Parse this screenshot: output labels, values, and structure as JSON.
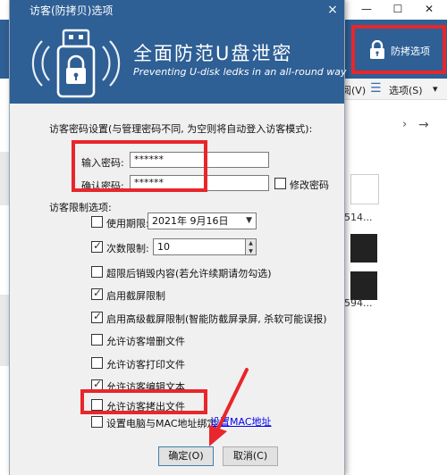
{
  "dialog": {
    "title": "访客(防拷贝)选项",
    "close_glyph": "×",
    "header_title": "全面防范U盘泄密",
    "header_subtitle": "Preventing U-disk ledks in an all-round way",
    "password_section_label": "访客密码设置(与管理密码不同, 为空则将自动登入访客模式):",
    "password": {
      "label": "输入密码:",
      "value": "******"
    },
    "confirm": {
      "label": "确认密码:",
      "value": "******"
    },
    "modify_password": {
      "label": "修改密码",
      "checked": false
    },
    "limits_label": "访客限制选项:",
    "options": [
      {
        "key": "expiry",
        "label": "使用期限:",
        "checked": false
      },
      {
        "key": "count",
        "label": "次数限制:",
        "checked": true
      },
      {
        "key": "destroy",
        "label": "超限后销毁内容(若允许续期请勿勾选)",
        "checked": false
      },
      {
        "key": "screenshot",
        "label": "启用截屏限制",
        "checked": true
      },
      {
        "key": "adv_screenshot",
        "label": "启用高级截屏限制(智能防截屏录屏, 杀软可能误报)",
        "checked": true
      },
      {
        "key": "delete",
        "label": "允许访客增删文件",
        "checked": false
      },
      {
        "key": "print",
        "label": "允许访客打印文件",
        "checked": false
      },
      {
        "key": "edit",
        "label": "允许访客编辑文本",
        "checked": true
      },
      {
        "key": "copy_out",
        "label": "允许访客拷出文件",
        "checked": false
      },
      {
        "key": "mac_bind",
        "label": "设置电脑与MAC地址绑定",
        "checked": false
      }
    ],
    "expiry_date": "2021年 9月16日",
    "count_value": "10",
    "mac_link": "设置MAC地址",
    "ok_button": "确定(O)",
    "cancel_button": "取消(C)"
  },
  "background": {
    "minimize_glyph": "—",
    "maximize_glyph": "☐",
    "close_glyph": "✕",
    "protect_button": "防拷选项",
    "toolbar_view": "阅(V)",
    "toolbar_options": "选项(S)",
    "toolbar_dropdown": "▾",
    "nav_forward": "→",
    "nav_more": "›",
    "file_numbers": [
      "514...",
      "594..."
    ]
  },
  "colors": {
    "banner": "#2e5f95",
    "highlight": "#e8262b"
  }
}
